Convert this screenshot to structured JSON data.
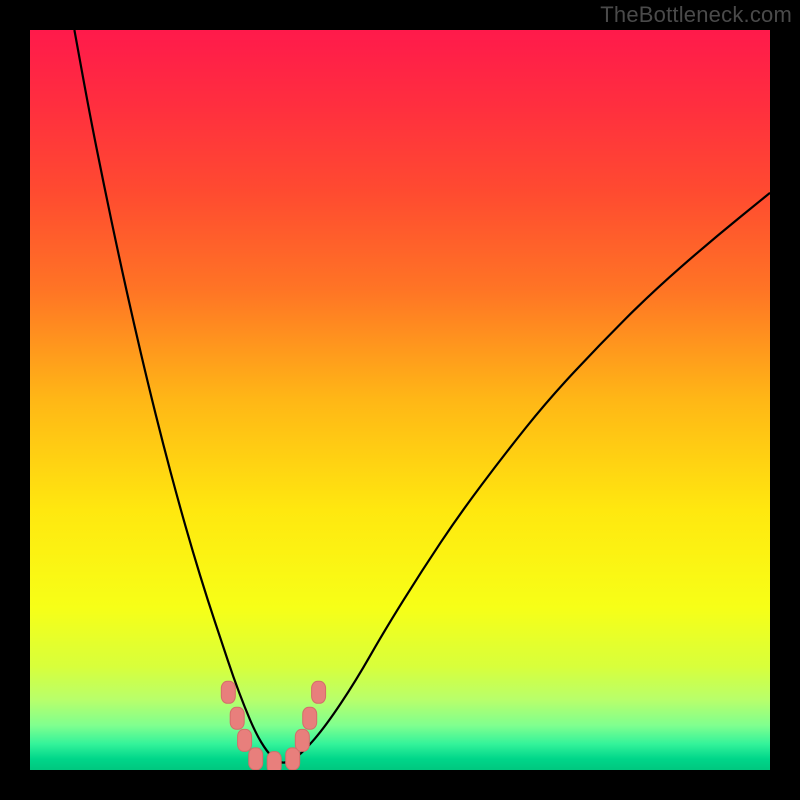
{
  "watermark": "TheBottleneck.com",
  "colors": {
    "frame": "#000000",
    "curve": "#000000",
    "marker_fill": "#e87f7c",
    "marker_stroke": "#d46d6a",
    "gradient_stops": [
      {
        "offset": 0.0,
        "color": "#ff1a4b"
      },
      {
        "offset": 0.1,
        "color": "#ff2e3f"
      },
      {
        "offset": 0.22,
        "color": "#ff4b30"
      },
      {
        "offset": 0.35,
        "color": "#ff7425"
      },
      {
        "offset": 0.5,
        "color": "#ffb716"
      },
      {
        "offset": 0.65,
        "color": "#ffe80f"
      },
      {
        "offset": 0.78,
        "color": "#f7ff17"
      },
      {
        "offset": 0.86,
        "color": "#d8ff3b"
      },
      {
        "offset": 0.905,
        "color": "#b8ff6b"
      },
      {
        "offset": 0.94,
        "color": "#7fff8f"
      },
      {
        "offset": 0.965,
        "color": "#33f39a"
      },
      {
        "offset": 0.985,
        "color": "#00d68a"
      },
      {
        "offset": 1.0,
        "color": "#00c77f"
      }
    ]
  },
  "chart_data": {
    "type": "line",
    "title": "",
    "xlabel": "",
    "ylabel": "",
    "xlim": [
      0,
      100
    ],
    "ylim": [
      0,
      100
    ],
    "series": [
      {
        "name": "bottleneck-curve",
        "x": [
          6,
          8,
          10,
          12,
          14,
          16,
          18,
          20,
          22,
          24,
          26,
          27.5,
          29,
          30.5,
          32,
          33.5,
          35,
          37,
          40,
          44,
          48,
          53,
          58,
          64,
          70,
          77,
          84,
          92,
          100
        ],
        "values": [
          100,
          89,
          79,
          69.5,
          60.5,
          52,
          44,
          36.5,
          29.5,
          23,
          17,
          12.5,
          8.5,
          5,
          2.5,
          1,
          1,
          2.5,
          6,
          12,
          19,
          27,
          34.5,
          42.5,
          50,
          57.5,
          64.5,
          71.5,
          78
        ]
      }
    ],
    "markers": {
      "name": "highlight-points",
      "points": [
        {
          "x": 26.8,
          "y": 10.5
        },
        {
          "x": 28.0,
          "y": 7.0
        },
        {
          "x": 29.0,
          "y": 4.0
        },
        {
          "x": 30.5,
          "y": 1.5
        },
        {
          "x": 33.0,
          "y": 1.0
        },
        {
          "x": 35.5,
          "y": 1.5
        },
        {
          "x": 36.8,
          "y": 4.0
        },
        {
          "x": 37.8,
          "y": 7.0
        },
        {
          "x": 39.0,
          "y": 10.5
        }
      ]
    }
  }
}
